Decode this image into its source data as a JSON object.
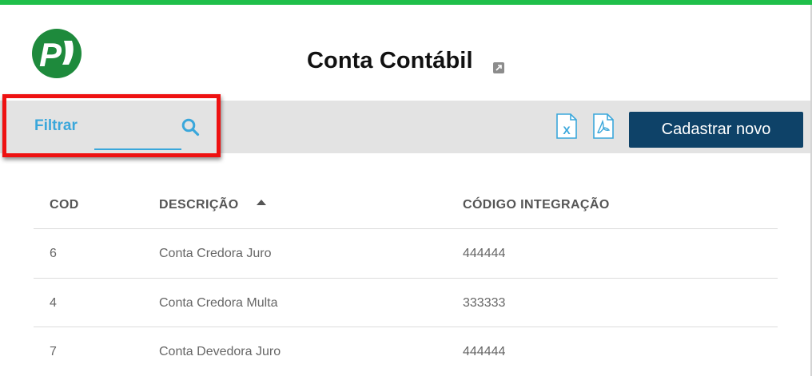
{
  "page": {
    "title": "Conta Contábil",
    "accent_color": "#1fbf4a",
    "logo_text": "P"
  },
  "toolbar": {
    "filter_label": "Filtrar",
    "filter_value": "",
    "new_button_label": "Cadastrar novo",
    "excel_icon": "excel-export-icon",
    "pdf_icon": "pdf-export-icon"
  },
  "table": {
    "headers": [
      "COD",
      "DESCRIÇÃO",
      "CÓDIGO INTEGRAÇÃO"
    ],
    "sorted_column": "DESCRIÇÃO",
    "sort_direction": "ascending",
    "rows": [
      {
        "cod": "6",
        "descricao": "Conta Credora Juro",
        "codigo_integracao": "444444"
      },
      {
        "cod": "4",
        "descricao": "Conta Credora Multa",
        "codigo_integracao": "333333"
      },
      {
        "cod": "7",
        "descricao": "Conta Devedora Juro",
        "codigo_integracao": "444444"
      }
    ]
  }
}
